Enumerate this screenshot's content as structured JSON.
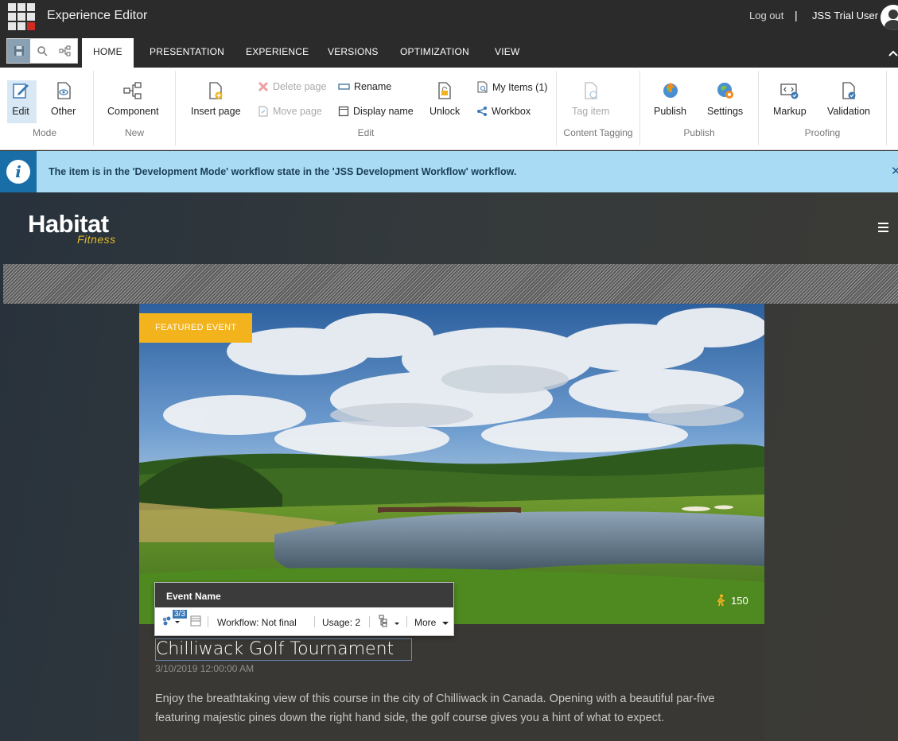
{
  "header": {
    "app_title": "Experience Editor",
    "logout": "Log out",
    "separator": "|",
    "user": "JSS Trial User"
  },
  "tabs": [
    "HOME",
    "PRESENTATION",
    "EXPERIENCE",
    "VERSIONS",
    "OPTIMIZATION",
    "VIEW"
  ],
  "ribbon": {
    "mode": {
      "label": "Mode",
      "edit": "Edit",
      "other": "Other"
    },
    "new": {
      "label": "New",
      "component": "Component"
    },
    "edit": {
      "label": "Edit",
      "insert_page": "Insert page",
      "delete_page": "Delete page",
      "move_page": "Move page",
      "rename": "Rename",
      "display_name": "Display name",
      "unlock": "Unlock",
      "my_items": "My Items (1)",
      "workbox": "Workbox"
    },
    "content_tagging": {
      "label": "Content Tagging",
      "tag_item": "Tag item"
    },
    "publish": {
      "label": "Publish",
      "publish": "Publish",
      "settings": "Settings"
    },
    "proofing": {
      "label": "Proofing",
      "markup": "Markup",
      "validation": "Validation"
    }
  },
  "info_bar": {
    "icon": "i",
    "message": "The item is in the 'Development Mode' workflow state in the 'JSS Development Workflow' workflow."
  },
  "site": {
    "logo": "Habitat",
    "logo_sub": "Fitness",
    "featured_badge": "FEATURED EVENT",
    "attendees": "150",
    "event_title": "Chilliwack Golf Tournament",
    "event_date": "3/10/2019 12:00:00 AM",
    "event_desc": "Enjoy the breathtaking view of this course in the city of Chilliwack in Canada. Opening with a beautiful par-five featuring majestic pines down the right hand side, the golf course gives you a hint of what to expect."
  },
  "chrome": {
    "title": "Event Name",
    "badge": "3/3",
    "workflow": "Workflow: Not final",
    "usage": "Usage: 2",
    "more": "More"
  },
  "colors": {
    "accent_yellow": "#f2b31c",
    "info_blue": "#a9dcf4",
    "dark_bar": "#2b2b2b"
  }
}
